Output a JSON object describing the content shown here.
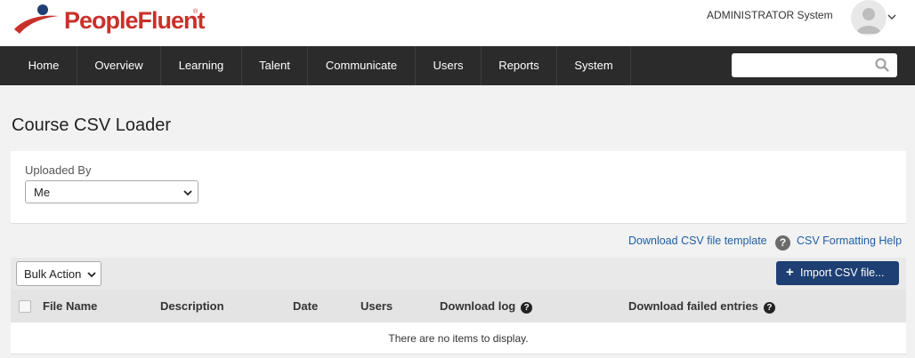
{
  "header": {
    "brand": "PeopleFluent",
    "brand_mark": "®",
    "user_name": "ADMINISTRATOR System"
  },
  "nav": {
    "items": [
      {
        "label": "Home"
      },
      {
        "label": "Overview"
      },
      {
        "label": "Learning"
      },
      {
        "label": "Talent"
      },
      {
        "label": "Communicate"
      },
      {
        "label": "Users"
      },
      {
        "label": "Reports"
      },
      {
        "label": "System"
      }
    ],
    "search": {
      "placeholder": "",
      "value": ""
    }
  },
  "page": {
    "title": "Course CSV Loader"
  },
  "filter": {
    "label": "Uploaded By",
    "selected": "Me"
  },
  "links": {
    "template": "Download CSV file template",
    "help": "CSV Formatting Help"
  },
  "toolbar": {
    "bulk_action": "Bulk Action",
    "import_label": "Import CSV file..."
  },
  "table": {
    "columns": [
      {
        "label": "File Name"
      },
      {
        "label": "Description"
      },
      {
        "label": "Date"
      },
      {
        "label": "Users"
      },
      {
        "label": "Download log"
      },
      {
        "label": "Download failed entries"
      }
    ],
    "empty_message": "There are no items to display."
  },
  "colors": {
    "brand_red": "#c8312b",
    "brand_blue": "#1e3f73",
    "nav_bg": "#2b2b2b",
    "link": "#1f5fa6"
  }
}
